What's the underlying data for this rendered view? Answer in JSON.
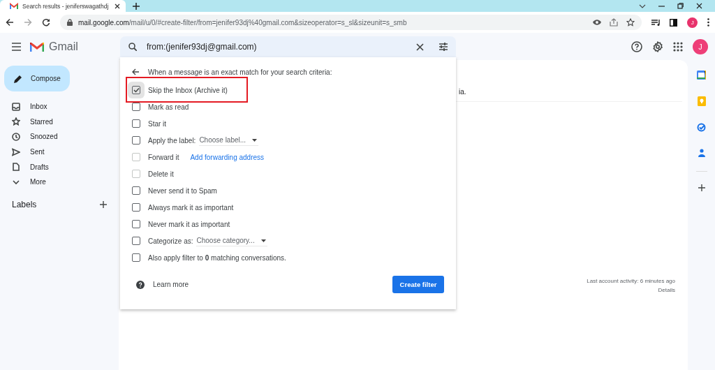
{
  "browser": {
    "tab_title": "Search results - jeniferswagathdj",
    "url_host": "mail.google.com",
    "url_path": "/mail/u/0/#create-filter/from=jenifer93dj%40gmail.com&sizeoperator=s_sl&sizeunit=s_smb",
    "profile_initial": "J"
  },
  "header": {
    "app_name": "Gmail",
    "search_value": "from:(jenifer93dj@gmail.com)",
    "avatar_initial": "J"
  },
  "sidebar": {
    "compose": "Compose",
    "items": [
      {
        "kind": "inbox",
        "label": "Inbox"
      },
      {
        "kind": "starred",
        "label": "Starred"
      },
      {
        "kind": "snoozed",
        "label": "Snoozed"
      },
      {
        "kind": "sent",
        "label": "Sent"
      },
      {
        "kind": "drafts",
        "label": "Drafts"
      },
      {
        "kind": "more",
        "label": "More"
      }
    ],
    "labels_heading": "Labels"
  },
  "main": {
    "partial_message": "ia.",
    "activity": "Last account activity: 6 minutes ago",
    "details_link": "Details"
  },
  "filter_dialog": {
    "heading": "When a message is an exact match for your search criteria:",
    "options": [
      {
        "kind": "plain",
        "label": "Skip the Inbox (Archive it)",
        "checked": true,
        "disabled": false,
        "highlighted": true
      },
      {
        "kind": "plain",
        "label": "Mark as read",
        "checked": false,
        "disabled": false,
        "highlighted": false
      },
      {
        "kind": "plain",
        "label": "Star it",
        "checked": false,
        "disabled": false,
        "highlighted": false
      },
      {
        "kind": "select",
        "label": "Apply the label:",
        "select": "Choose label...",
        "checked": false,
        "disabled": false,
        "highlighted": false
      },
      {
        "kind": "link",
        "label": "Forward it",
        "link": "Add forwarding address",
        "checked": false,
        "disabled": true,
        "highlighted": false
      },
      {
        "kind": "plain",
        "label": "Delete it",
        "checked": false,
        "disabled": true,
        "highlighted": false
      },
      {
        "kind": "plain",
        "label": "Never send it to Spam",
        "checked": false,
        "disabled": false,
        "highlighted": false
      },
      {
        "kind": "plain",
        "label": "Always mark it as important",
        "checked": false,
        "disabled": false,
        "highlighted": false
      },
      {
        "kind": "plain",
        "label": "Never mark it as important",
        "checked": false,
        "disabled": false,
        "highlighted": false
      },
      {
        "kind": "select",
        "label": "Categorize as:",
        "select": "Choose category...",
        "checked": false,
        "disabled": false,
        "highlighted": false
      },
      {
        "kind": "plain",
        "label": "Also apply filter to **0** matching conversations.",
        "checked": false,
        "disabled": false,
        "highlighted": false
      }
    ],
    "learn_more": "Learn more",
    "create_button": "Create filter"
  }
}
